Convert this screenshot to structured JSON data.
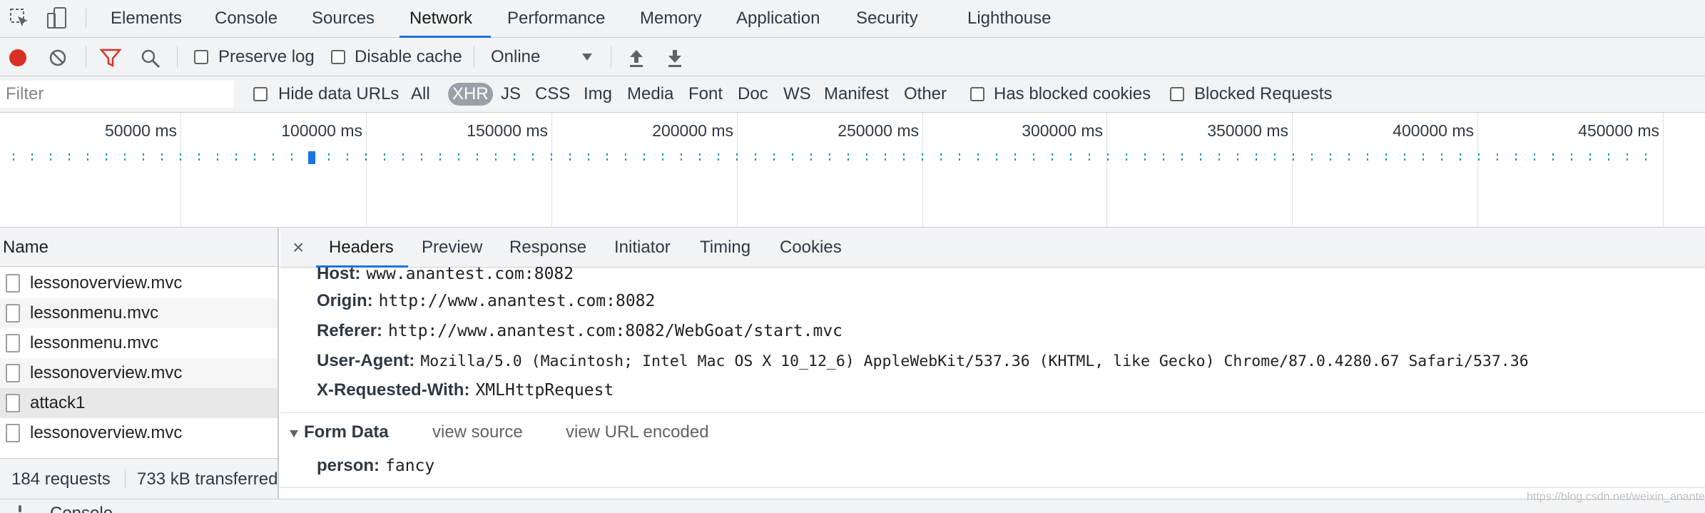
{
  "top_tabs": [
    {
      "label": "Elements"
    },
    {
      "label": "Console"
    },
    {
      "label": "Sources"
    },
    {
      "label": "Network"
    },
    {
      "label": "Performance"
    },
    {
      "label": "Memory"
    },
    {
      "label": "Application"
    },
    {
      "label": "Security"
    },
    {
      "label": "Lighthouse"
    }
  ],
  "active_tab": "Network",
  "toolbar": {
    "preserve_log_label": "Preserve log",
    "disable_cache_label": "Disable cache",
    "throttling_value": "Online",
    "record_color": "#d93025"
  },
  "filterbar": {
    "placeholder": "Filter",
    "hide_data_urls_label": "Hide data URLs",
    "types": [
      "All",
      "XHR",
      "JS",
      "CSS",
      "Img",
      "Media",
      "Font",
      "Doc",
      "WS",
      "Manifest",
      "Other"
    ],
    "selected_type": "XHR",
    "has_blocked_cookies_label": "Has blocked cookies",
    "blocked_requests_label": "Blocked Requests"
  },
  "overview": {
    "ticks": [
      "50000 ms",
      "100000 ms",
      "150000 ms",
      "200000 ms",
      "250000 ms",
      "300000 ms",
      "350000 ms",
      "400000 ms",
      "450000 ms"
    ]
  },
  "requests": {
    "header": "Name",
    "rows": [
      {
        "name": "lessonoverview.mvc"
      },
      {
        "name": "lessonmenu.mvc"
      },
      {
        "name": "lessonmenu.mvc"
      },
      {
        "name": "lessonoverview.mvc"
      },
      {
        "name": "attack1"
      },
      {
        "name": "lessonoverview.mvc"
      }
    ],
    "selected_row": "attack1",
    "status": {
      "requests": "184 requests",
      "transferred": "733 kB transferred"
    }
  },
  "details": {
    "close_glyph": "×",
    "tabs": [
      "Headers",
      "Preview",
      "Response",
      "Initiator",
      "Timing",
      "Cookies"
    ],
    "active_tab": "Headers",
    "headers": [
      {
        "key": "Host:",
        "value": "www.anantest.com:8082"
      },
      {
        "key": "Origin:",
        "value": "http://www.anantest.com:8082"
      },
      {
        "key": "Referer:",
        "value": "http://www.anantest.com:8082/WebGoat/start.mvc"
      },
      {
        "key": "User-Agent:",
        "value": "Mozilla/5.0 (Macintosh; Intel Mac OS X 10_12_6) AppleWebKit/537.36 (KHTML, like Gecko) Chrome/87.0.4280.67 Safari/537.36"
      },
      {
        "key": "X-Requested-With:",
        "value": "XMLHttpRequest"
      }
    ],
    "form_data": {
      "title": "Form Data",
      "view_source": "view source",
      "view_url_encoded": "view URL encoded",
      "fields": [
        {
          "key": "person:",
          "value": "fancy"
        }
      ]
    }
  },
  "drawer": {
    "label": "Console"
  },
  "watermark": "https://blog.csdn.net/weixin_anantest"
}
